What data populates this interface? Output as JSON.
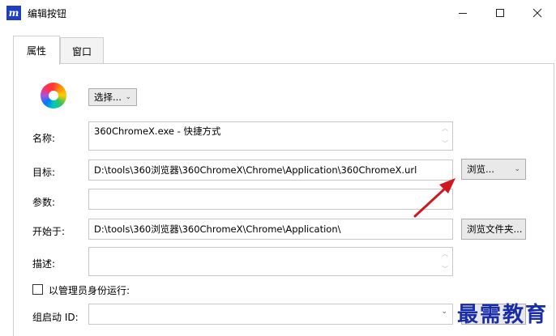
{
  "window": {
    "title": "编辑按钮"
  },
  "tabs": [
    {
      "label": "属性"
    },
    {
      "label": "窗口"
    }
  ],
  "choose_button": "选择...",
  "name": {
    "label": "名称:",
    "value": "360ChromeX.exe - 快捷方式"
  },
  "target": {
    "label": "目标:",
    "value": "D:\\tools\\360浏览器\\360ChromeX\\Chrome\\Application\\360ChromeX.url",
    "browse_label": "浏览..."
  },
  "params": {
    "label": "参数:",
    "value": ""
  },
  "start_in": {
    "label": "开始于:",
    "value": "D:\\tools\\360浏览器\\360ChromeX\\Chrome\\Application\\",
    "browse_folder_label": "浏览文件夹..."
  },
  "description": {
    "label": "描述:",
    "value": ""
  },
  "run_as_admin": {
    "label": "以管理员身份运行:",
    "checked": false
  },
  "group_id": {
    "label": "组启动 ID:",
    "value": ""
  },
  "watermark": "最需教育",
  "colors": {
    "arrow": "#d0181e",
    "watermark": "#1a2da8",
    "app_icon": "#1f3fbf"
  }
}
